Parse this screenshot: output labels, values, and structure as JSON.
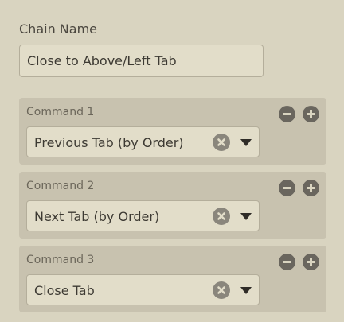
{
  "chain": {
    "label": "Chain Name",
    "value": "Close to Above/Left Tab"
  },
  "commands": [
    {
      "label": "Command 1",
      "value": "Previous Tab (by Order)"
    },
    {
      "label": "Command 2",
      "value": "Next Tab (by Order)"
    },
    {
      "label": "Command 3",
      "value": "Close Tab"
    }
  ],
  "icons": {
    "remove": "minus-circle-icon",
    "add": "plus-circle-icon",
    "clear": "x-circle-icon",
    "dropdown": "caret-down-icon"
  },
  "colors": {
    "background": "#d9d4c0",
    "card": "#c8c2af",
    "input": "#e2ddc9",
    "button": "#6a665e"
  }
}
